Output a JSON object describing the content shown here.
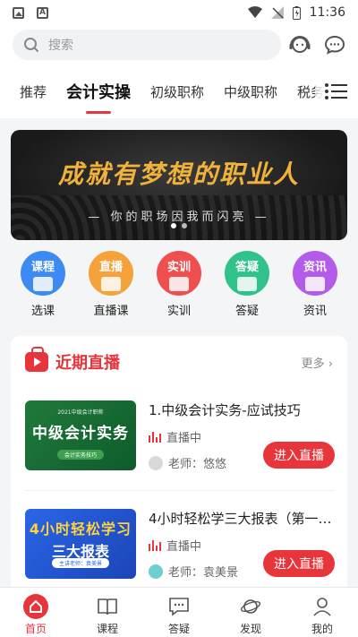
{
  "status_bar": {
    "time": "11:36"
  },
  "search": {
    "placeholder": "搜索"
  },
  "tabs": [
    "推荐",
    "会计实操",
    "初级职称",
    "中级职称",
    "税务"
  ],
  "banner": {
    "title": "成就有梦想的职业人",
    "subtitle": "— 你的职场因我而闪亮 —"
  },
  "categories": [
    {
      "badge": "课程",
      "label": "选课",
      "color": "#3d8bf2"
    },
    {
      "badge": "直播",
      "label": "直播课",
      "color": "#f6a23b"
    },
    {
      "badge": "实训",
      "label": "实训",
      "color": "#ef4f4f"
    },
    {
      "badge": "答疑",
      "label": "答疑",
      "color": "#2fc28a"
    },
    {
      "badge": "资讯",
      "label": "资讯",
      "color": "#b35bea"
    }
  ],
  "live_section": {
    "title": "近期直播",
    "more": "更多",
    "courses": [
      {
        "title": "1.中级会计实务-应试技巧",
        "status": "直播中",
        "teacher": "老师：悠悠",
        "button": "进入直播",
        "thumb_top": "2021中级会计职称",
        "thumb_main": "中级会计实务",
        "thumb_pill": "会计实务技巧"
      },
      {
        "title": "4小时轻松学三大报表（第一…",
        "status": "直播中",
        "teacher": "老师：袁美景",
        "button": "进入直播",
        "thumb_main": "4小时轻松学习",
        "thumb_main2": "三大报表",
        "thumb_pill": "主讲老师：袁美景"
      }
    ]
  },
  "bottom_nav": [
    "首页",
    "课程",
    "答疑",
    "发现",
    "我的"
  ]
}
